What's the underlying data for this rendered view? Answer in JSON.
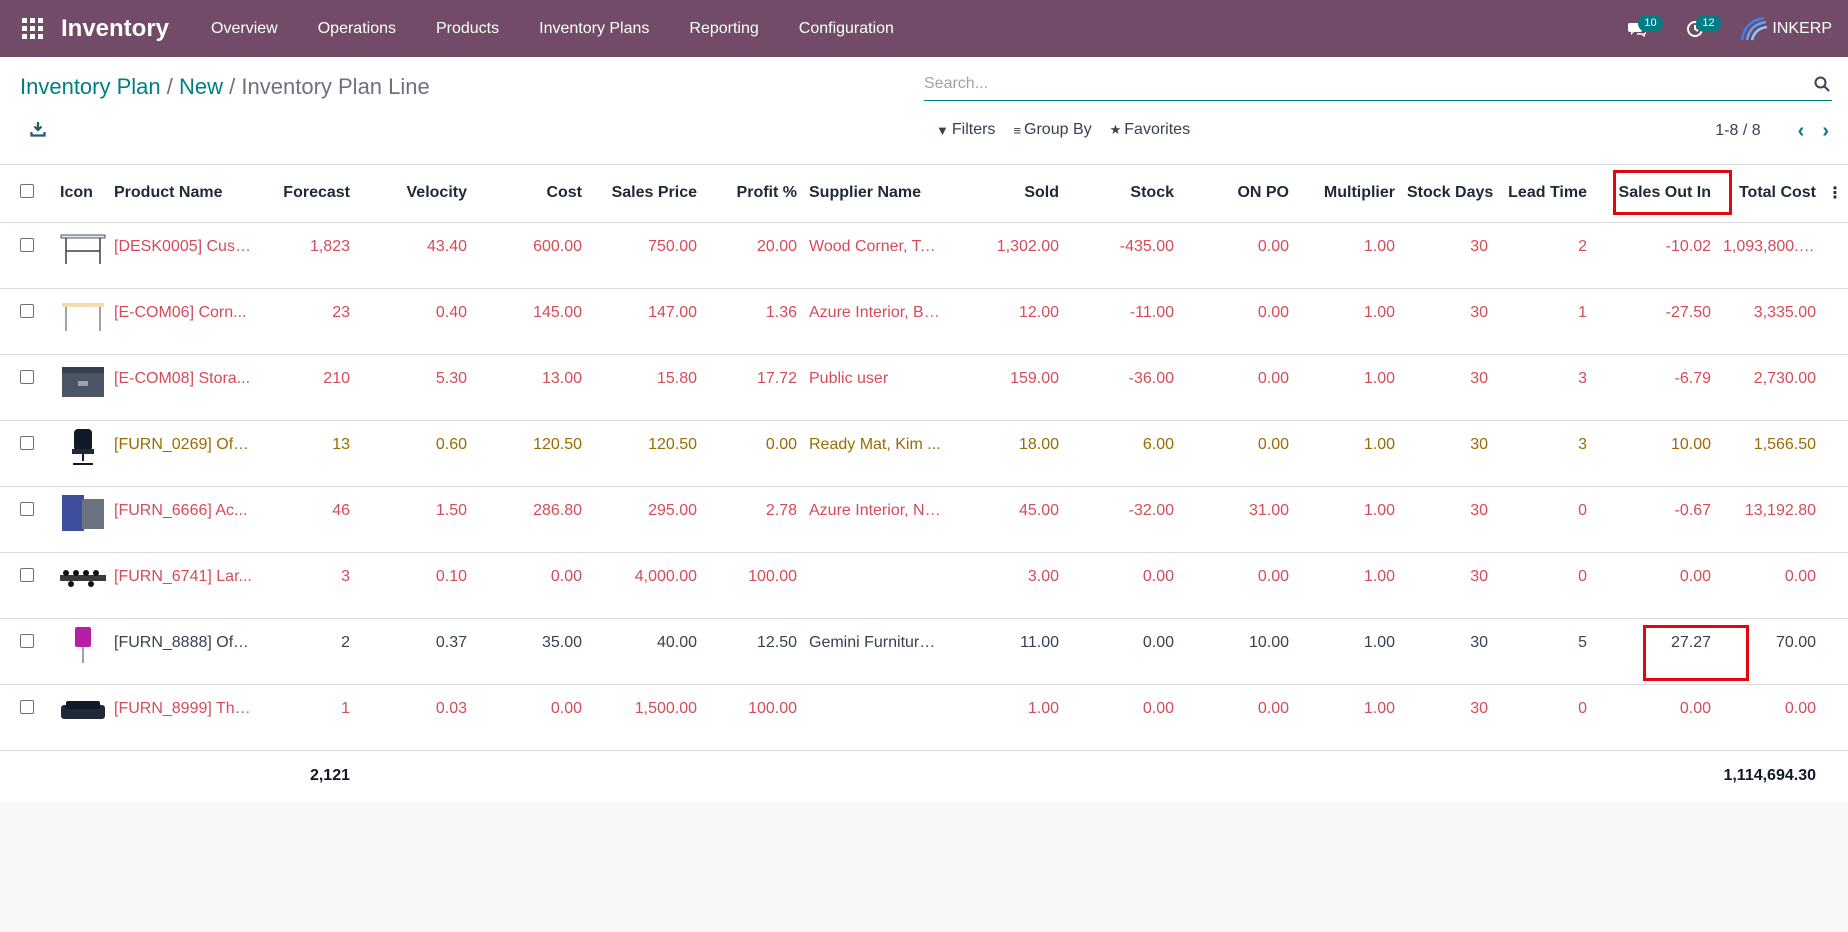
{
  "navbar": {
    "brand": "Inventory",
    "menu": [
      "Overview",
      "Operations",
      "Products",
      "Inventory Plans",
      "Reporting",
      "Configuration"
    ],
    "messages_badge": "10",
    "activities_badge": "12",
    "company": "INKERP"
  },
  "breadcrumb": {
    "items": [
      "Inventory Plan",
      "New"
    ],
    "current": "Inventory Plan Line",
    "separator": "/"
  },
  "search": {
    "placeholder": "Search..."
  },
  "filters": {
    "filters_label": "Filters",
    "group_by_label": "Group By",
    "favorites_label": "Favorites"
  },
  "pager": {
    "value": "1-8 / 8"
  },
  "table": {
    "columns": [
      "Icon",
      "Product Name",
      "Forecast",
      "Velocity",
      "Cost",
      "Sales Price",
      "Profit %",
      "Supplier Name",
      "Sold",
      "Stock",
      "ON PO",
      "Multiplier",
      "Stock Days",
      "Lead Time",
      "Sales Out In",
      "Total Cost"
    ],
    "rows": [
      {
        "status": "red",
        "icon": "desk-image",
        "product": "[DESK0005] Cust...",
        "forecast": "1,823",
        "velocity": "43.40",
        "cost": "600.00",
        "sales_price": "750.00",
        "profit": "20.00",
        "supplier": "Wood Corner, To...",
        "sold": "1,302.00",
        "stock": "-435.00",
        "on_po": "0.00",
        "multiplier": "1.00",
        "stock_days": "30",
        "lead_time": "2",
        "sales_out_in": "-10.02",
        "total_cost": "1,093,800.00"
      },
      {
        "status": "red",
        "icon": "corner-desk-image",
        "product": "[E-COM06] Corn...",
        "forecast": "23",
        "velocity": "0.40",
        "cost": "145.00",
        "sales_price": "147.00",
        "profit": "1.36",
        "supplier": "Azure Interior, Br...",
        "sold": "12.00",
        "stock": "-11.00",
        "on_po": "0.00",
        "multiplier": "1.00",
        "stock_days": "30",
        "lead_time": "1",
        "sales_out_in": "-27.50",
        "total_cost": "3,335.00"
      },
      {
        "status": "red",
        "icon": "storage-box-image",
        "product": "[E-COM08] Stora...",
        "forecast": "210",
        "velocity": "5.30",
        "cost": "13.00",
        "sales_price": "15.80",
        "profit": "17.72",
        "supplier": "Public user",
        "sold": "159.00",
        "stock": "-36.00",
        "on_po": "0.00",
        "multiplier": "1.00",
        "stock_days": "30",
        "lead_time": "3",
        "sales_out_in": "-6.79",
        "total_cost": "2,730.00"
      },
      {
        "status": "yellow",
        "icon": "office-chair-image",
        "product": "[FURN_0269] Offi...",
        "forecast": "13",
        "velocity": "0.60",
        "cost": "120.50",
        "sales_price": "120.50",
        "profit": "0.00",
        "supplier": "Ready Mat, Kim ...",
        "sold": "18.00",
        "stock": "6.00",
        "on_po": "0.00",
        "multiplier": "1.00",
        "stock_days": "30",
        "lead_time": "3",
        "sales_out_in": "10.00",
        "total_cost": "1,566.50"
      },
      {
        "status": "red",
        "icon": "acoustic-panel-image",
        "product": "[FURN_6666] Ac...",
        "forecast": "46",
        "velocity": "1.50",
        "cost": "286.80",
        "sales_price": "295.00",
        "profit": "2.78",
        "supplier": "Azure Interior, Ni...",
        "sold": "45.00",
        "stock": "-32.00",
        "on_po": "31.00",
        "multiplier": "1.00",
        "stock_days": "30",
        "lead_time": "0",
        "sales_out_in": "-0.67",
        "total_cost": "13,192.80"
      },
      {
        "status": "red",
        "icon": "conference-table-image",
        "product": "[FURN_6741] Lar...",
        "forecast": "3",
        "velocity": "0.10",
        "cost": "0.00",
        "sales_price": "4,000.00",
        "profit": "100.00",
        "supplier": "",
        "sold": "3.00",
        "stock": "0.00",
        "on_po": "0.00",
        "multiplier": "1.00",
        "stock_days": "30",
        "lead_time": "0",
        "sales_out_in": "0.00",
        "total_cost": "0.00"
      },
      {
        "status": "normal",
        "icon": "floor-lamp-image",
        "product": "[FURN_8888] Offi...",
        "forecast": "2",
        "velocity": "0.37",
        "cost": "35.00",
        "sales_price": "40.00",
        "profit": "12.50",
        "supplier": "Gemini Furniture,...",
        "sold": "11.00",
        "stock": "0.00",
        "on_po": "10.00",
        "multiplier": "1.00",
        "stock_days": "30",
        "lead_time": "5",
        "sales_out_in": "27.27",
        "total_cost": "70.00"
      },
      {
        "status": "red",
        "icon": "sofa-image",
        "product": "[FURN_8999] Thr...",
        "forecast": "1",
        "velocity": "0.03",
        "cost": "0.00",
        "sales_price": "1,500.00",
        "profit": "100.00",
        "supplier": "",
        "sold": "1.00",
        "stock": "0.00",
        "on_po": "0.00",
        "multiplier": "1.00",
        "stock_days": "30",
        "lead_time": "0",
        "sales_out_in": "0.00",
        "total_cost": "0.00"
      }
    ],
    "totals": {
      "forecast": "2,121",
      "total_cost": "1,114,694.30"
    }
  },
  "colors": {
    "navbar": "#714b67",
    "accent": "#017e84",
    "danger_row": "#d44c59",
    "warning_row": "#9a6b01",
    "highlight": "#e0070f"
  }
}
